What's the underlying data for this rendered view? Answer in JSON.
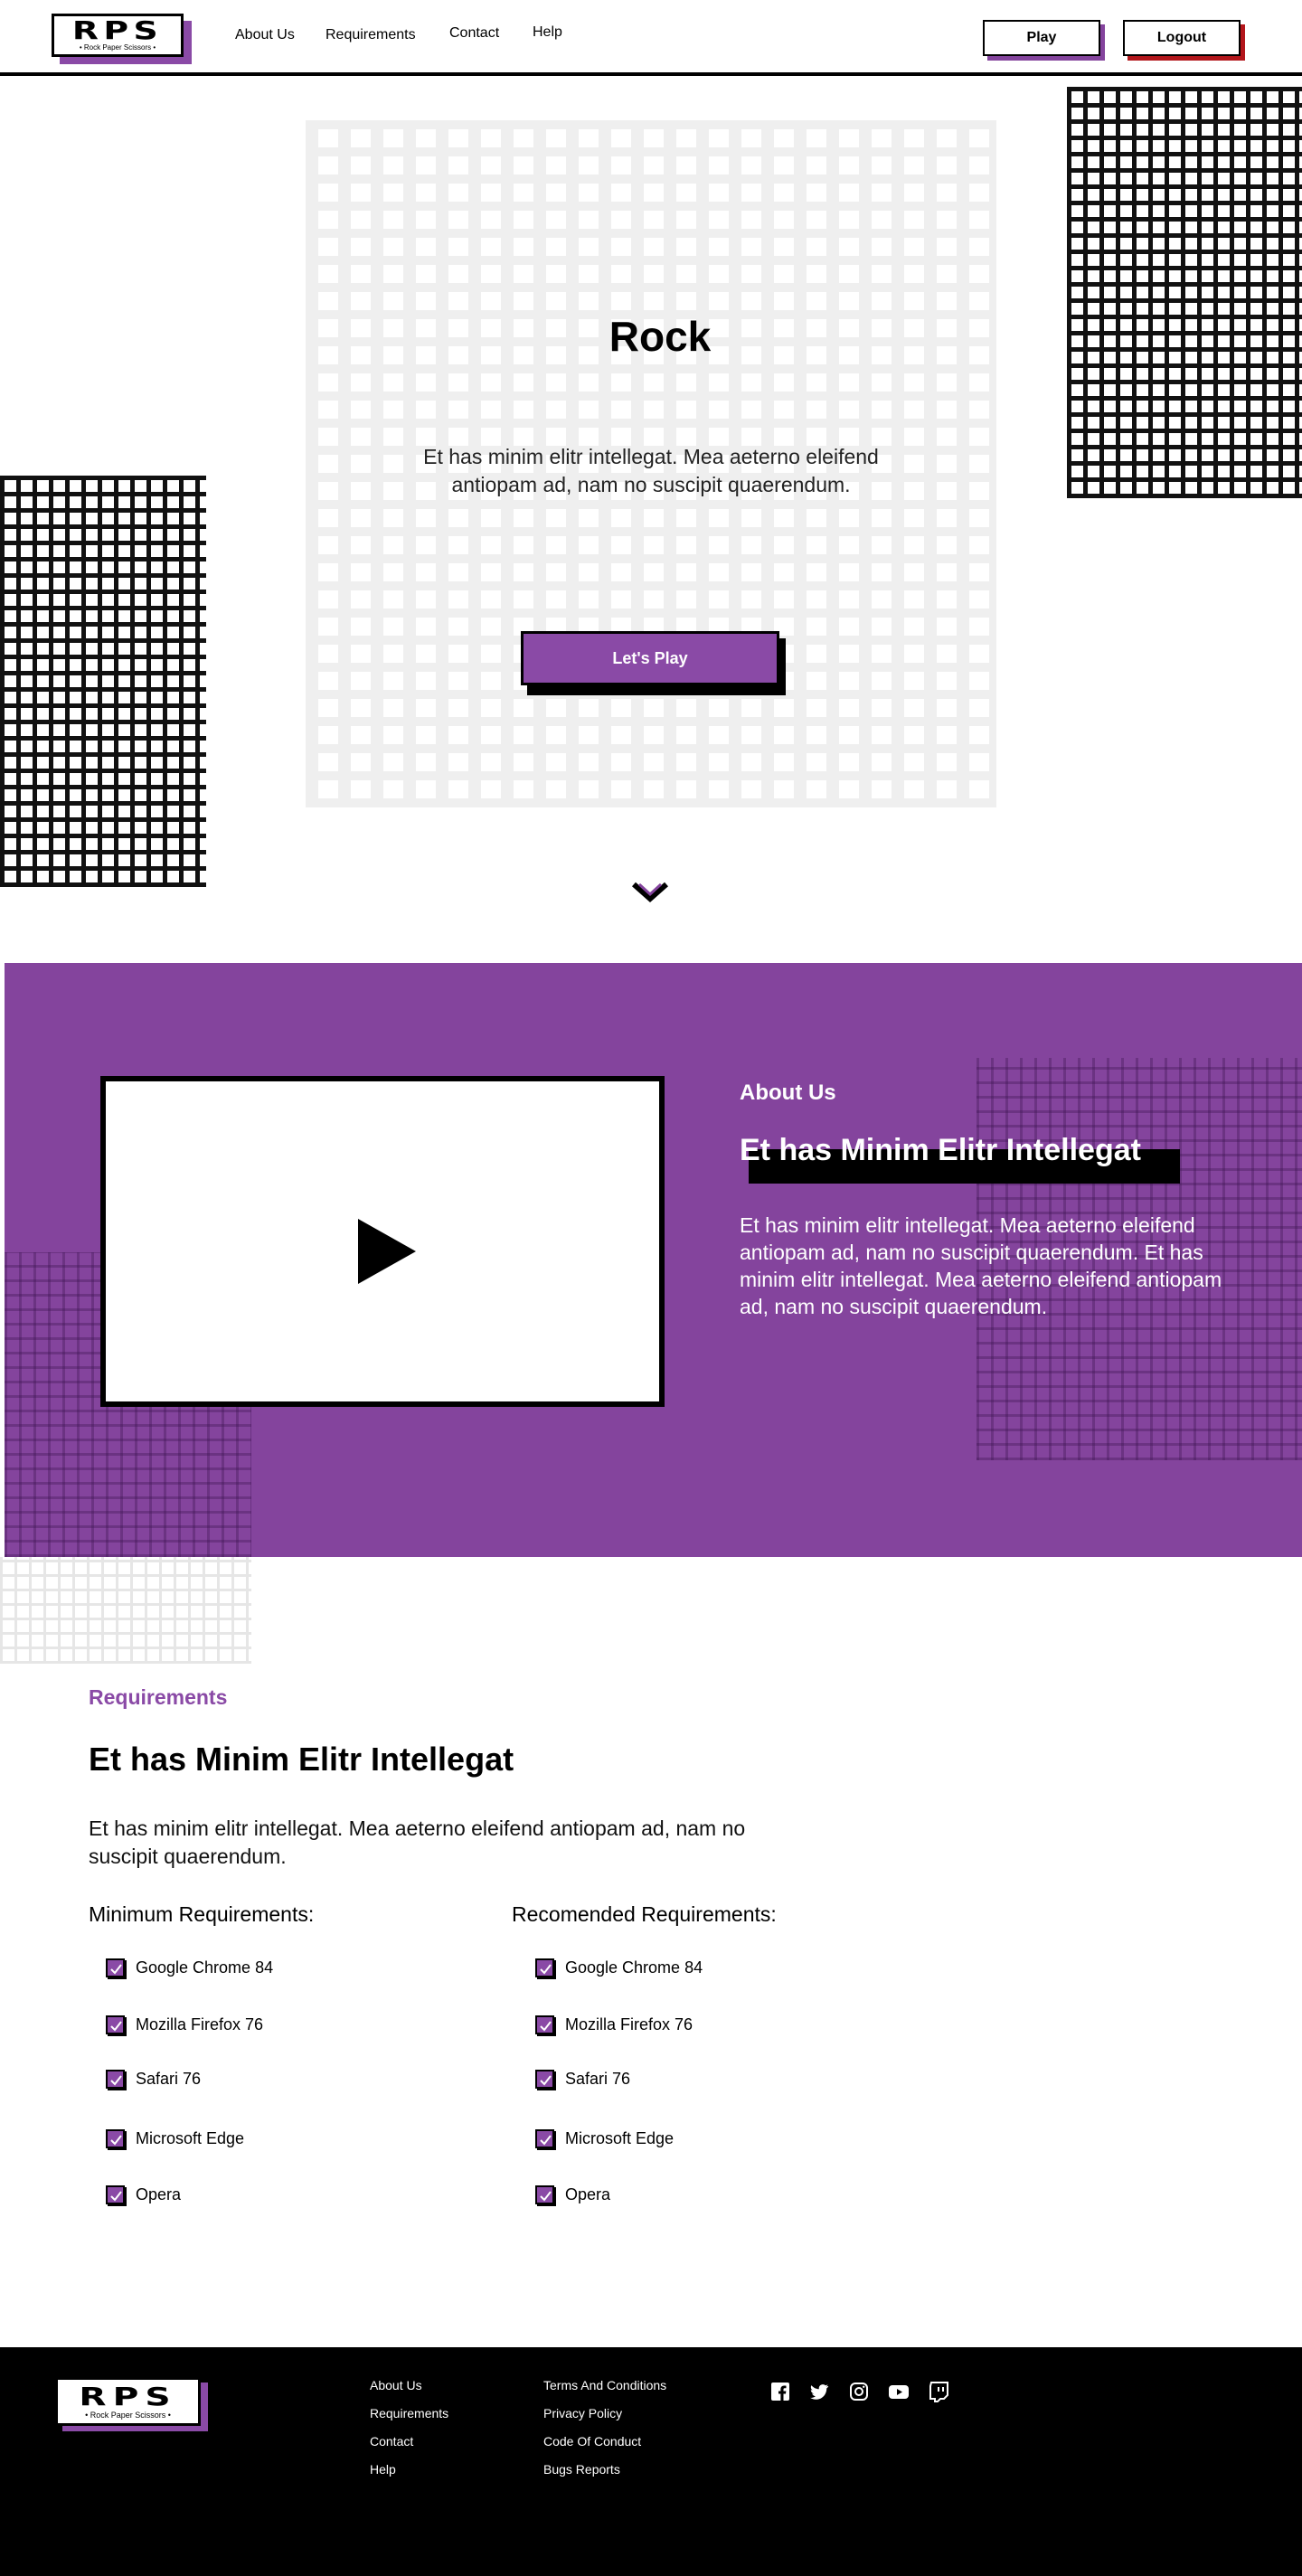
{
  "header": {
    "logo": {
      "big": "RPS",
      "small": "• Rock Paper Scissors •"
    },
    "nav": [
      "About Us",
      "Requirements",
      "Contact",
      "Help"
    ],
    "play_label": "Play",
    "logout_label": "Logout"
  },
  "hero": {
    "title": "Rock",
    "text": "Et has minim elitr intellegat. Mea aeterno eleifend antiopam ad, nam no suscipit quaerendum.",
    "cta_label": "Let's Play"
  },
  "about": {
    "eyebrow": "About Us",
    "title": "Et has Minim Elitr Intellegat",
    "text": "Et has minim elitr intellegat. Mea aeterno eleifend antiopam ad, nam no suscipit quaerendum. Et has minim elitr intellegat. Mea aeterno eleifend antiopam ad, nam no suscipit quaerendum."
  },
  "requirements": {
    "eyebrow": "Requirements",
    "title": "Et has Minim Elitr Intellegat",
    "text": "Et has minim elitr intellegat. Mea aeterno eleifend antiopam ad, nam no suscipit quaerendum.",
    "minimum": {
      "title": "Minimum Requirements:",
      "items": [
        "Google Chrome 84",
        "Mozilla Firefox 76",
        "Safari 76",
        "Microsoft Edge",
        "Opera"
      ]
    },
    "recommended": {
      "title": "Recomended Requirements:",
      "items": [
        "Google Chrome 84",
        "Mozilla Firefox 76",
        "Safari 76",
        "Microsoft Edge",
        "Opera"
      ]
    }
  },
  "footer": {
    "logo": {
      "big": "RPS",
      "small": "• Rock Paper Scissors •"
    },
    "links_col1": [
      "About Us",
      "Requirements",
      "Contact",
      "Help"
    ],
    "links_col2": [
      "Terms And Conditions",
      "Privacy Policy",
      "Code Of Conduct",
      "Bugs Reports"
    ],
    "social_icons": [
      "facebook-icon",
      "twitter-icon",
      "instagram-icon",
      "youtube-icon",
      "twitch-icon"
    ]
  },
  "colors": {
    "accent": "#84449d",
    "danger": "#b3161b",
    "text": "#000000",
    "footer_bg": "#000000"
  }
}
